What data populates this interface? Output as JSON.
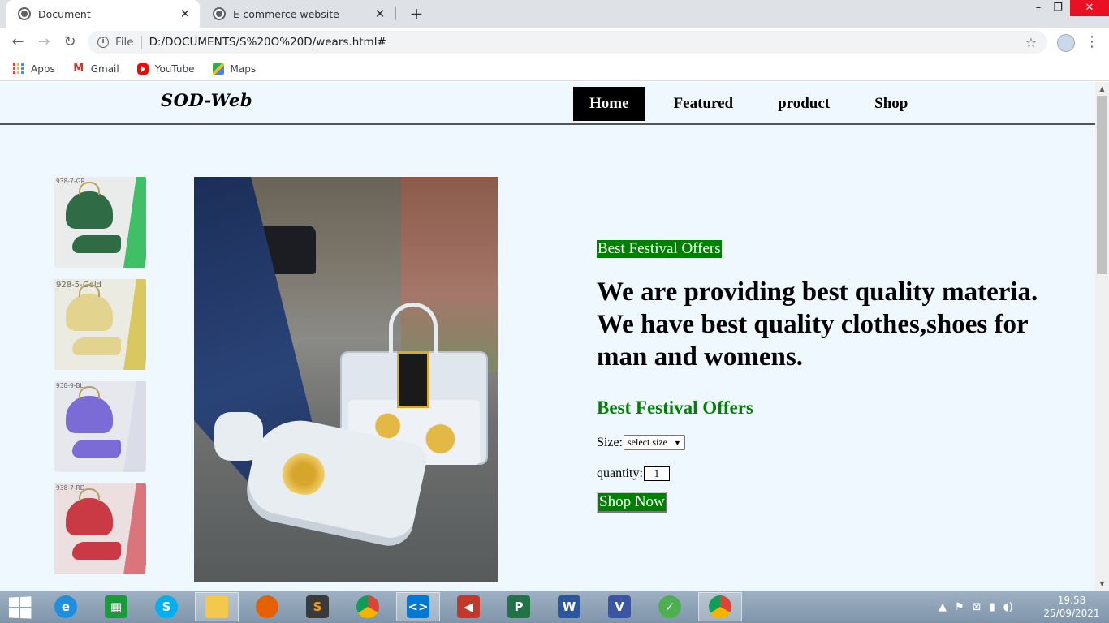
{
  "browser": {
    "tabs": [
      {
        "title": "Document",
        "active": true
      },
      {
        "title": "E-commerce website",
        "active": false
      }
    ],
    "new_tab_label": "+",
    "window_controls": {
      "minimize": "–",
      "maximize": "❐",
      "close": "✕"
    },
    "nav": {
      "back": "←",
      "forward": "→",
      "reload": "↻"
    },
    "address": {
      "info_icon": "i",
      "scheme_label": "File",
      "url": "D:/DOCUMENTS/S%20O%20D/wears.html#",
      "star": "☆"
    },
    "menu_dots": "⋮",
    "bookmarks": [
      {
        "label": "Apps",
        "icon": "apps-grid-icon"
      },
      {
        "label": "Gmail",
        "icon": "gmail-icon"
      },
      {
        "label": "YouTube",
        "icon": "youtube-icon"
      },
      {
        "label": "Maps",
        "icon": "maps-icon"
      }
    ]
  },
  "page": {
    "logo": "SOD-Web",
    "nav": [
      "Home",
      "Featured",
      "product",
      "Shop"
    ],
    "active_nav": "Home",
    "thumbnails": [
      {
        "tag": "938-7-GR"
      },
      {
        "tag": "928-5-Gold"
      },
      {
        "tag": "938-9-BL"
      },
      {
        "tag": "938-7-RD"
      }
    ],
    "product": {
      "badge": "Best Festival Offers",
      "headline": "We are providing best quality materia. We have best quality clothes,shoes for man and womens.",
      "sub_offer": "Best Festival Offers",
      "size_label": "Size:",
      "size_select": "select size",
      "quantity_label": "quantity:",
      "quantity_value": "1",
      "shop_button": "Shop Now"
    },
    "colors": {
      "background": "#f0f8ff",
      "accent_green": "#008000",
      "nav_active_bg": "#000000"
    }
  },
  "taskbar": {
    "apps": [
      "internet-explorer",
      "windows-store",
      "skype",
      "file-explorer",
      "firefox",
      "sublime-text",
      "chrome",
      "vs-code",
      "audio",
      "project",
      "word",
      "visio",
      "greenshot",
      "chrome-active"
    ],
    "clock": {
      "time": "19:58",
      "date": "25/09/2021"
    }
  }
}
